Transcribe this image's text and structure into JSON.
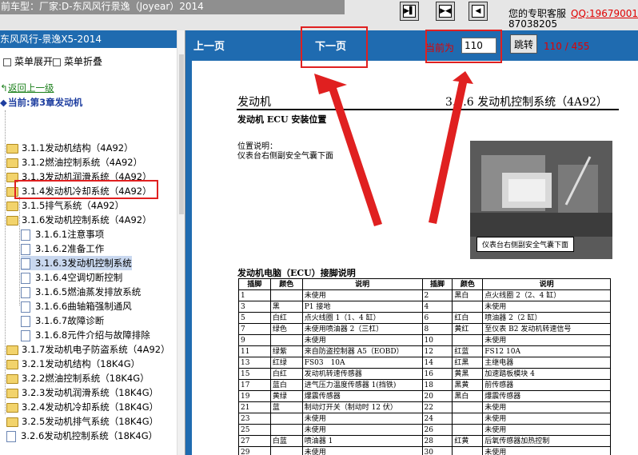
{
  "app": {
    "title": "前车型：厂家:D-东风风行景逸（Joyear）2014",
    "customer_service": "您的专职客服",
    "qq": "QQ:19679001",
    "phone": "87038205"
  },
  "nav_buttons": [
    {
      "name": "first",
      "glyph": "▶▌"
    },
    {
      "name": "toggle",
      "glyph": "▶◀"
    },
    {
      "name": "last",
      "glyph": "◀"
    }
  ],
  "sidebar": {
    "book_title": "东风风行-景逸X5-2014",
    "expand_label": "菜单展开",
    "collapse_label": "菜单折叠",
    "back_label": "返回上一级",
    "current_label": "当前:第3章发动机",
    "items": [
      {
        "label": "3.1.1发动机结构（4A92）",
        "type": "folder"
      },
      {
        "label": "3.1.2燃油控制系统（4A92）",
        "type": "folder"
      },
      {
        "label": "3.1.3发动机润滑系统（4A92）",
        "type": "folder"
      },
      {
        "label": "3.1.4发动机冷却系统（4A92）",
        "type": "folder"
      },
      {
        "label": "3.1.5排气系统（4A92）",
        "type": "folder"
      },
      {
        "label": "3.1.6发动机控制系统（4A92）",
        "type": "folder"
      },
      {
        "label": "3.1.6.1注意事项",
        "type": "doc"
      },
      {
        "label": "3.1.6.2准备工作",
        "type": "doc"
      },
      {
        "label": "3.1.6.3发动机控制系统",
        "type": "doc"
      },
      {
        "label": "3.1.6.4空调切断控制",
        "type": "doc"
      },
      {
        "label": "3.1.6.5燃油蒸发排放系统",
        "type": "doc"
      },
      {
        "label": "3.1.6.6曲轴箱强制通风",
        "type": "doc"
      },
      {
        "label": "3.1.6.7故障诊断",
        "type": "doc"
      },
      {
        "label": "3.1.6.8元件介绍与故障排除",
        "type": "doc"
      },
      {
        "label": "3.1.7发动机电子防盗系统（4A92）",
        "type": "folder"
      },
      {
        "label": "3.2.1发动机结构（18K4G）",
        "type": "folder"
      },
      {
        "label": "3.2.2燃油控制系统（18K4G）",
        "type": "folder"
      },
      {
        "label": "3.2.3发动机润滑系统（18K4G）",
        "type": "folder"
      },
      {
        "label": "3.2.4发动机冷却系统（18K4G）",
        "type": "folder"
      },
      {
        "label": "3.2.5发动机排气系统（18K4G）",
        "type": "folder"
      },
      {
        "label": "3.2.6发动机控制系统（18K4G）",
        "type": "doc"
      }
    ]
  },
  "pager": {
    "prev_label": "上一页",
    "next_label": "下一页",
    "current_label": "当前为",
    "page_value": "110",
    "jump_label": "跳转",
    "page_count": "110 / 455"
  },
  "document": {
    "heading_left": "发动机",
    "heading_right": "3.1.6 发动机控制系统（4A92）",
    "ecu_title": "发动机 ECU 安装位置",
    "pos_label": "位置说明：",
    "pos_text": "仪表台右侧副安全气囊下面",
    "photo_caption": "仪表台右侧副安全气囊下面",
    "pin_title": "发动机电脑（ECU）接脚说明",
    "table_headers": [
      "插脚",
      "颜色",
      "说明",
      "插脚",
      "颜色",
      "说明"
    ],
    "table_rows": [
      [
        "1",
        "",
        "未使用",
        "2",
        "黑白",
        "点火线圈 2（2、4 缸）"
      ],
      [
        "3",
        "黑",
        "P1 接地",
        "4",
        "",
        "未使用"
      ],
      [
        "5",
        "白红",
        "点火线圈 1（1、4 缸）",
        "6",
        "红白",
        "喷油器 2（2 缸）"
      ],
      [
        "7",
        "绿色",
        "未使用喷油器 2（三杠）",
        "8",
        "黄红",
        "至仪表 B2 发动机转速信号"
      ],
      [
        "9",
        "",
        "未使用",
        "10",
        "",
        "未使用"
      ],
      [
        "11",
        "绿紫",
        "来自防盗控制器 A5（EOBD）",
        "12",
        "红蓝",
        "FS12 10A"
      ],
      [
        "13",
        "红绿",
        "FS03　10A",
        "14",
        "红黑",
        "主继电器"
      ],
      [
        "15",
        "白红",
        "发动机转速传感器",
        "16",
        "黄黑",
        "加速踏板模块 4"
      ],
      [
        "17",
        "蓝白",
        "进气压力温度传感器 1(挡铁)",
        "18",
        "黑黄",
        "前传感器"
      ],
      [
        "19",
        "黄绿",
        "爆震传感器",
        "20",
        "黑白",
        "爆震传感器"
      ],
      [
        "21",
        "蓝",
        "制动灯开关（制动时 12 伏）",
        "22",
        "",
        "未使用"
      ],
      [
        "23",
        "",
        "未使用",
        "24",
        "",
        "未使用"
      ],
      [
        "25",
        "",
        "未使用",
        "26",
        "",
        "未使用"
      ],
      [
        "27",
        "白蓝",
        "喷油器 1",
        "28",
        "红黄",
        "后氧传感器加热控制"
      ],
      [
        "29",
        "",
        "未使用",
        "30",
        "",
        "未使用"
      ]
    ]
  }
}
